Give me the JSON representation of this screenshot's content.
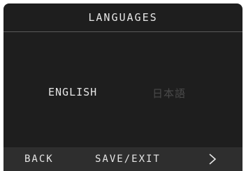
{
  "screen": {
    "title": "LANGUAGES"
  },
  "languages": [
    {
      "label": "ENGLISH",
      "state": "selected"
    },
    {
      "label": "日本語",
      "state": "inactive"
    }
  ],
  "footer": {
    "back_label": "BACK",
    "save_exit_label": "SAVE/EXIT",
    "next_icon": "chevron-right-icon"
  },
  "colors": {
    "screen_bg": "#1e1e1e",
    "footer_bg": "#2e2e2e",
    "text_active": "#e6e6e6",
    "text_inactive": "#4a4a4a",
    "divider": "#5a5a5a"
  }
}
